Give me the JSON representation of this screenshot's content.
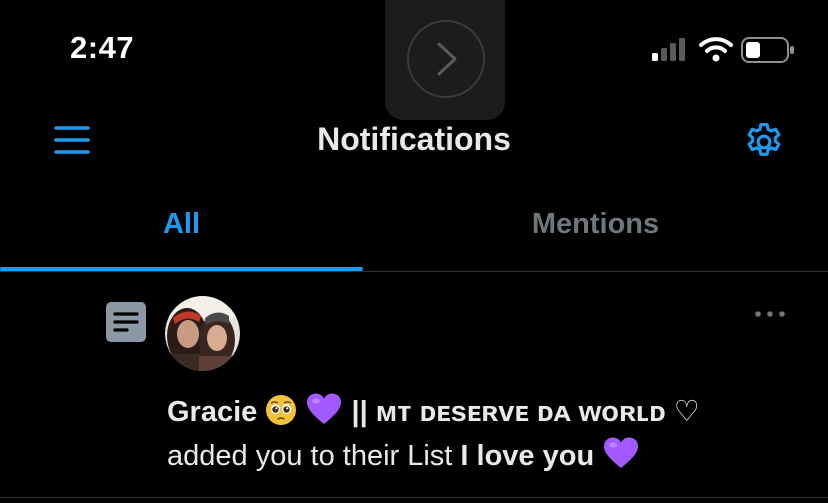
{
  "status_bar": {
    "time": "2:47"
  },
  "header": {
    "title": "Notifications"
  },
  "tabs": [
    {
      "label": "All",
      "selected": true
    },
    {
      "label": "Mentions",
      "selected": false
    }
  ],
  "notification": {
    "icon": "list-icon",
    "user_name_prefix": "Gracie",
    "user_name_suffix": "|| ᴍᴛ ᴅᴇsᴇʀᴠᴇ ᴅᴀ ᴡᴏʀʟᴅ ♡",
    "action_text": "added you to their List",
    "list_name": "I love you"
  },
  "colors": {
    "accent": "#1d9bf0",
    "background": "#000000",
    "muted_text": "#71767b",
    "primary_text": "#e7e9ea",
    "purple_heart": "#a259ff"
  }
}
